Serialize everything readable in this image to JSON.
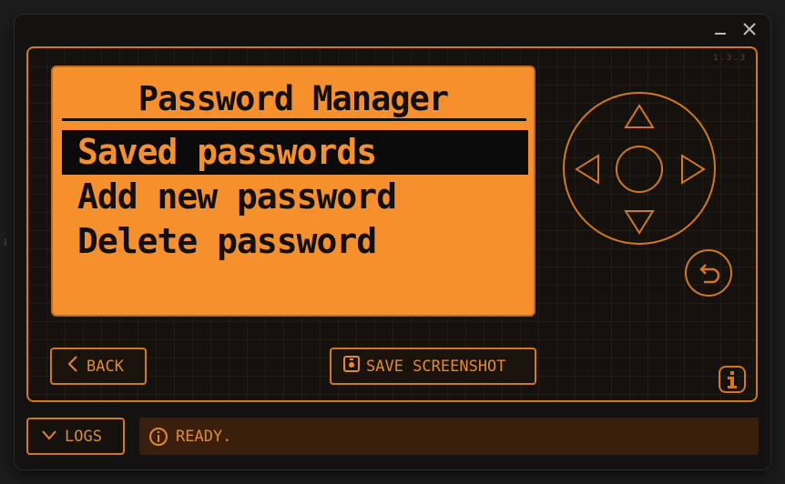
{
  "window": {
    "minimize_label": "_",
    "close_label": "×",
    "version": "1.3.3"
  },
  "screen": {
    "title": "Password Manager",
    "menu": [
      {
        "label": "Saved passwords",
        "selected": true
      },
      {
        "label": "Add new password",
        "selected": false
      },
      {
        "label": "Delete password",
        "selected": false
      }
    ]
  },
  "controls": {
    "back_label": "BACK",
    "save_screenshot_label": "SAVE SCREENSHOT",
    "logs_label": "LOGS"
  },
  "status": {
    "text": "READY."
  },
  "icons": {
    "minimize": "minimize-icon",
    "close": "close-icon",
    "dpad_up": "arrow-up-icon",
    "dpad_down": "arrow-down-icon",
    "dpad_left": "arrow-left-icon",
    "dpad_right": "arrow-right-icon",
    "undo": "undo-icon",
    "back": "chevron-left-icon",
    "camera": "camera-icon",
    "info": "info-icon",
    "logs": "chevron-down-icon",
    "status": "info-circle-icon"
  },
  "colors": {
    "accent": "#d2791f",
    "screen_bg": "#f5902c",
    "status_bg": "#3a1f0c"
  }
}
